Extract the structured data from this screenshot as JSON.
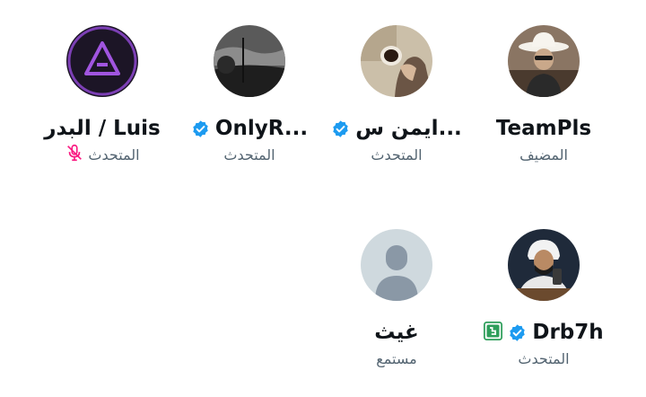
{
  "participants": [
    {
      "name": "TeamPls",
      "role": "المضيف",
      "verified": false,
      "avatar_icon": "cowboy-hat-avatar"
    },
    {
      "name": "ايمن س...",
      "role": "المتحدث",
      "verified": true,
      "avatar_icon": "coffee-hand-avatar"
    },
    {
      "name": "OnlyR...",
      "role": "المتحدث",
      "verified": true,
      "avatar_icon": "night-sky-avatar"
    },
    {
      "name": "البدر / Luis",
      "role": "المتحدث",
      "verified": false,
      "muted": true,
      "avatar_icon": "purple-logo-avatar"
    },
    {
      "name": "Drb7h",
      "role": "المتحدث",
      "verified": true,
      "extra_badge": "green-app-badge-icon",
      "avatar_icon": "man-with-mic-avatar"
    },
    {
      "name": "غيث",
      "role": "مستمع",
      "verified": false,
      "avatar_icon": "default-person-avatar"
    }
  ],
  "colors": {
    "verified": "#1d9bf0",
    "muted_mic": "#f91880",
    "text_primary": "#0f1419",
    "text_secondary": "#536471",
    "green_badge": "#2e9e5b"
  }
}
